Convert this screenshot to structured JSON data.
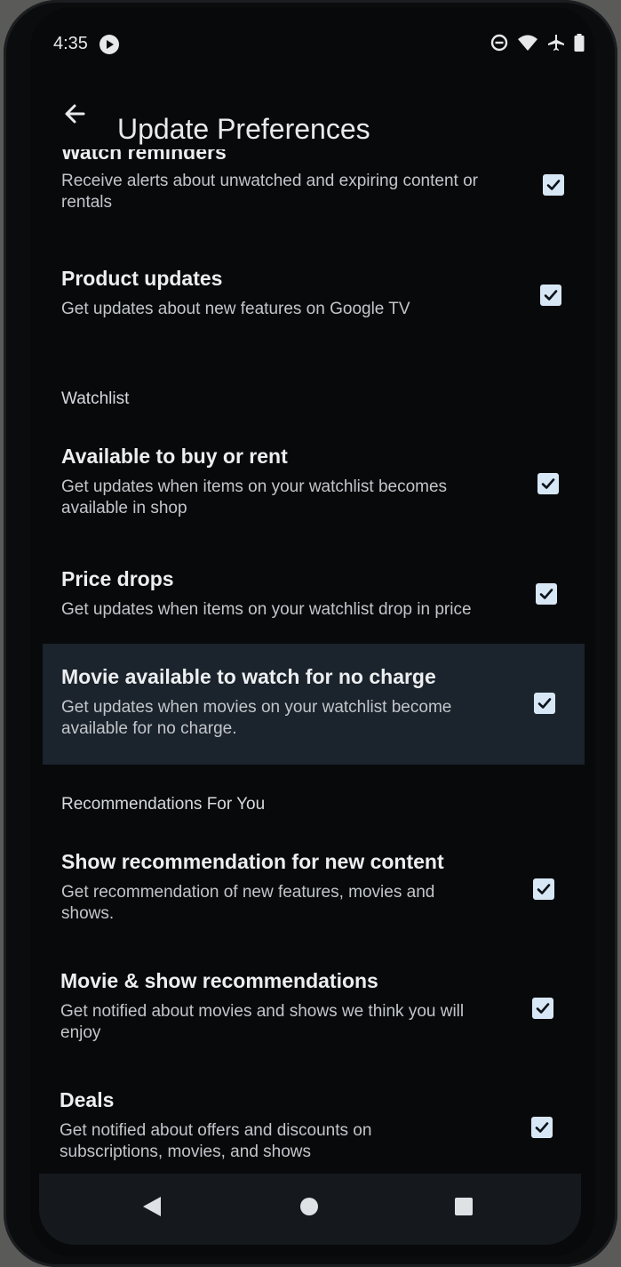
{
  "status_bar": {
    "time": "4:35",
    "icons": [
      "cast-icon",
      "do-not-disturb-icon",
      "wifi-icon",
      "airplane-mode-icon",
      "battery-icon"
    ]
  },
  "app_bar": {
    "back_icon": "arrow-back-icon",
    "title": "Update Preferences"
  },
  "rows_top": [
    {
      "title": "Watch reminders",
      "description": "Receive alerts about unwatched and expiring content or rentals",
      "checked": true
    },
    {
      "title": "Product updates",
      "description": "Get updates about new features on Google TV",
      "checked": true
    }
  ],
  "sections": [
    {
      "header": "Watchlist",
      "rows": [
        {
          "title": "Available to buy or rent",
          "description": "Get updates when items on your watchlist becomes available in shop",
          "checked": true
        },
        {
          "title": "Price drops",
          "description": "Get updates when items on your watchlist drop in price",
          "checked": true
        },
        {
          "title": "Movie available to watch for no charge",
          "description": "Get updates when movies on your watchlist become available for no charge.",
          "checked": true,
          "highlighted": true
        }
      ]
    },
    {
      "header": "Recommendations For You",
      "rows": [
        {
          "title": "Show recommendation for new content",
          "description": "Get recommendation of new features, movies and shows.",
          "checked": true
        },
        {
          "title": "Movie & show recommendations",
          "description": "Get notified about movies and shows we think you will enjoy",
          "checked": true
        },
        {
          "title": "Deals",
          "description": "Get notified about offers and discounts on subscriptions, movies, and shows",
          "checked": true
        }
      ]
    }
  ],
  "nav_bar": {
    "icons": [
      "nav-back-icon",
      "nav-home-icon",
      "nav-recents-icon"
    ]
  },
  "colors": {
    "background": "#07090b",
    "highlight_row": "#1b232c",
    "checkbox_fill": "#d8e7f5",
    "checkmark": "#0b1218",
    "title_text": "#eceef0",
    "description_text": "#c2c6ca"
  }
}
